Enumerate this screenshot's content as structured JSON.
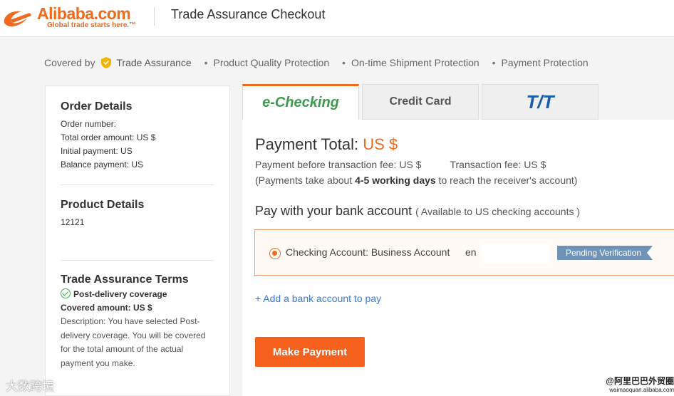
{
  "header": {
    "logo_text": "Alibaba.com",
    "logo_tagline": "Global trade starts here.™",
    "page_title": "Trade Assurance Checkout"
  },
  "protection": {
    "covered_by": "Covered by",
    "trade_assurance": "Trade Assurance",
    "items": [
      "Product Quality Protection",
      "On-time Shipment Protection",
      "Payment Protection"
    ]
  },
  "order_details": {
    "title": "Order Details",
    "order_number": "Order number:",
    "total_amount": "Total order amount: US $",
    "initial_payment": "Initial payment: US",
    "balance_payment": "Balance payment: US"
  },
  "product_details": {
    "title": "Product Details",
    "value": "12121"
  },
  "trade_terms": {
    "title": "Trade Assurance Terms",
    "coverage": "Post-delivery coverage",
    "covered_amount": "Covered amount: US $",
    "description": "Description: You have selected Post-delivery coverage. You will be covered for the total amount of the actual payment you make."
  },
  "tabs": [
    {
      "label": "e-Checking",
      "active": true
    },
    {
      "label": "Credit Card",
      "active": false
    },
    {
      "label": "T/T",
      "active": false
    }
  ],
  "payment": {
    "total_label": "Payment Total:",
    "total_amount": "US $",
    "fee_before": "Payment before transaction fee: US $",
    "fee": "Transaction fee: US $",
    "note_pre": "(Payments take about ",
    "note_bold": "4-5 working days",
    "note_post": " to reach the receiver's account)",
    "bank_heading": "Pay with your bank account",
    "bank_sub": "( Available to US checking accounts )",
    "account_label": "Checking Account: Business Account",
    "account_name_fragment": "en",
    "status": "Pending Verification",
    "add_bank": "+ Add a bank account to pay",
    "submit": "Make Payment"
  },
  "watermarks": {
    "left": "大数跨境",
    "right_top": "@阿里巴巴外贸圈",
    "right_bottom": "waimaoquan.alibaba.com"
  },
  "colors": {
    "brand_orange": "#f06a1e",
    "button_orange": "#f5611c",
    "echeck_green": "#3a9b4d",
    "tt_blue": "#1b5eb0",
    "link_blue": "#3a7bd5",
    "pending_badge": "#6f93b8"
  }
}
